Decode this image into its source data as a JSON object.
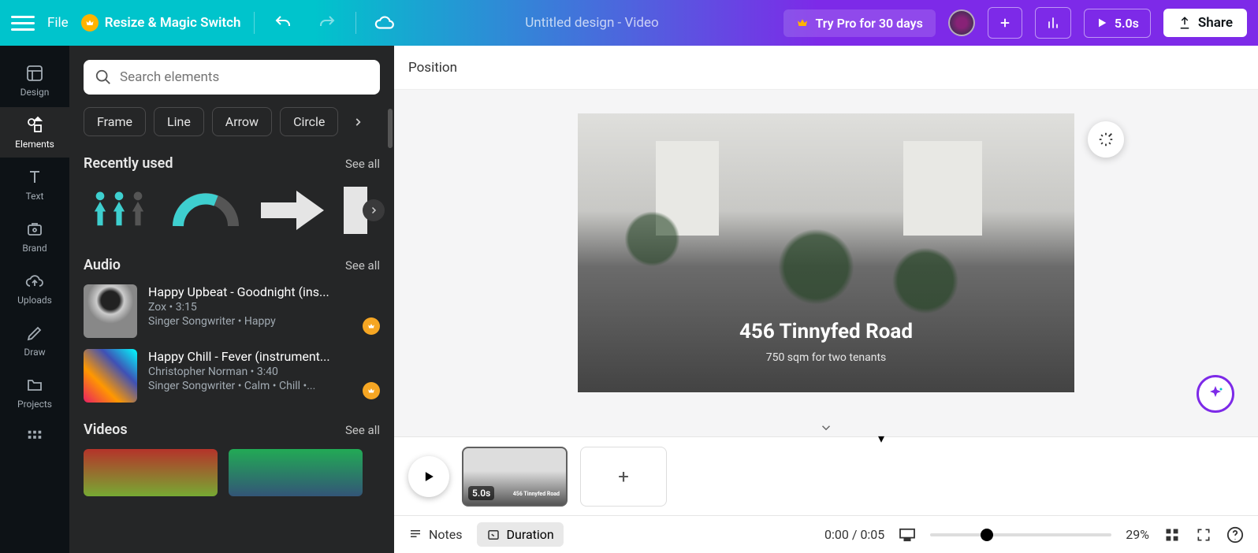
{
  "topbar": {
    "file": "File",
    "resize": "Resize & Magic Switch",
    "title": "Untitled design - Video",
    "try_pro": "Try Pro for 30 days",
    "duration_badge": "5.0s",
    "share": "Share"
  },
  "rail": {
    "design": "Design",
    "elements": "Elements",
    "text": "Text",
    "brand": "Brand",
    "uploads": "Uploads",
    "draw": "Draw",
    "projects": "Projects"
  },
  "panel": {
    "search_placeholder": "Search elements",
    "chips": {
      "frame": "Frame",
      "line": "Line",
      "arrow": "Arrow",
      "circle": "Circle"
    },
    "sections": {
      "recent": {
        "title": "Recently used",
        "see_all": "See all"
      },
      "audio": {
        "title": "Audio",
        "see_all": "See all"
      },
      "videos": {
        "title": "Videos",
        "see_all": "See all"
      }
    },
    "audio": [
      {
        "title": "Happy Upbeat - Goodnight (ins...",
        "artist_duration": "Zox • 3:15",
        "tags": "Singer Songwriter • Happy"
      },
      {
        "title": "Happy Chill - Fever (instrument...",
        "artist_duration": "Christopher Norman • 3:40",
        "tags": "Singer Songwriter • Calm • Chill •..."
      }
    ]
  },
  "context": {
    "position": "Position"
  },
  "design": {
    "title": "456 Tinnyfed Road",
    "subtitle": "750 sqm for two tenants"
  },
  "timeline": {
    "frame_duration": "5.0s",
    "frame_caption": "456 Tinnyfed Road"
  },
  "bottombar": {
    "notes": "Notes",
    "duration": "Duration",
    "time": "0:00 / 0:05",
    "zoom": "29%"
  }
}
